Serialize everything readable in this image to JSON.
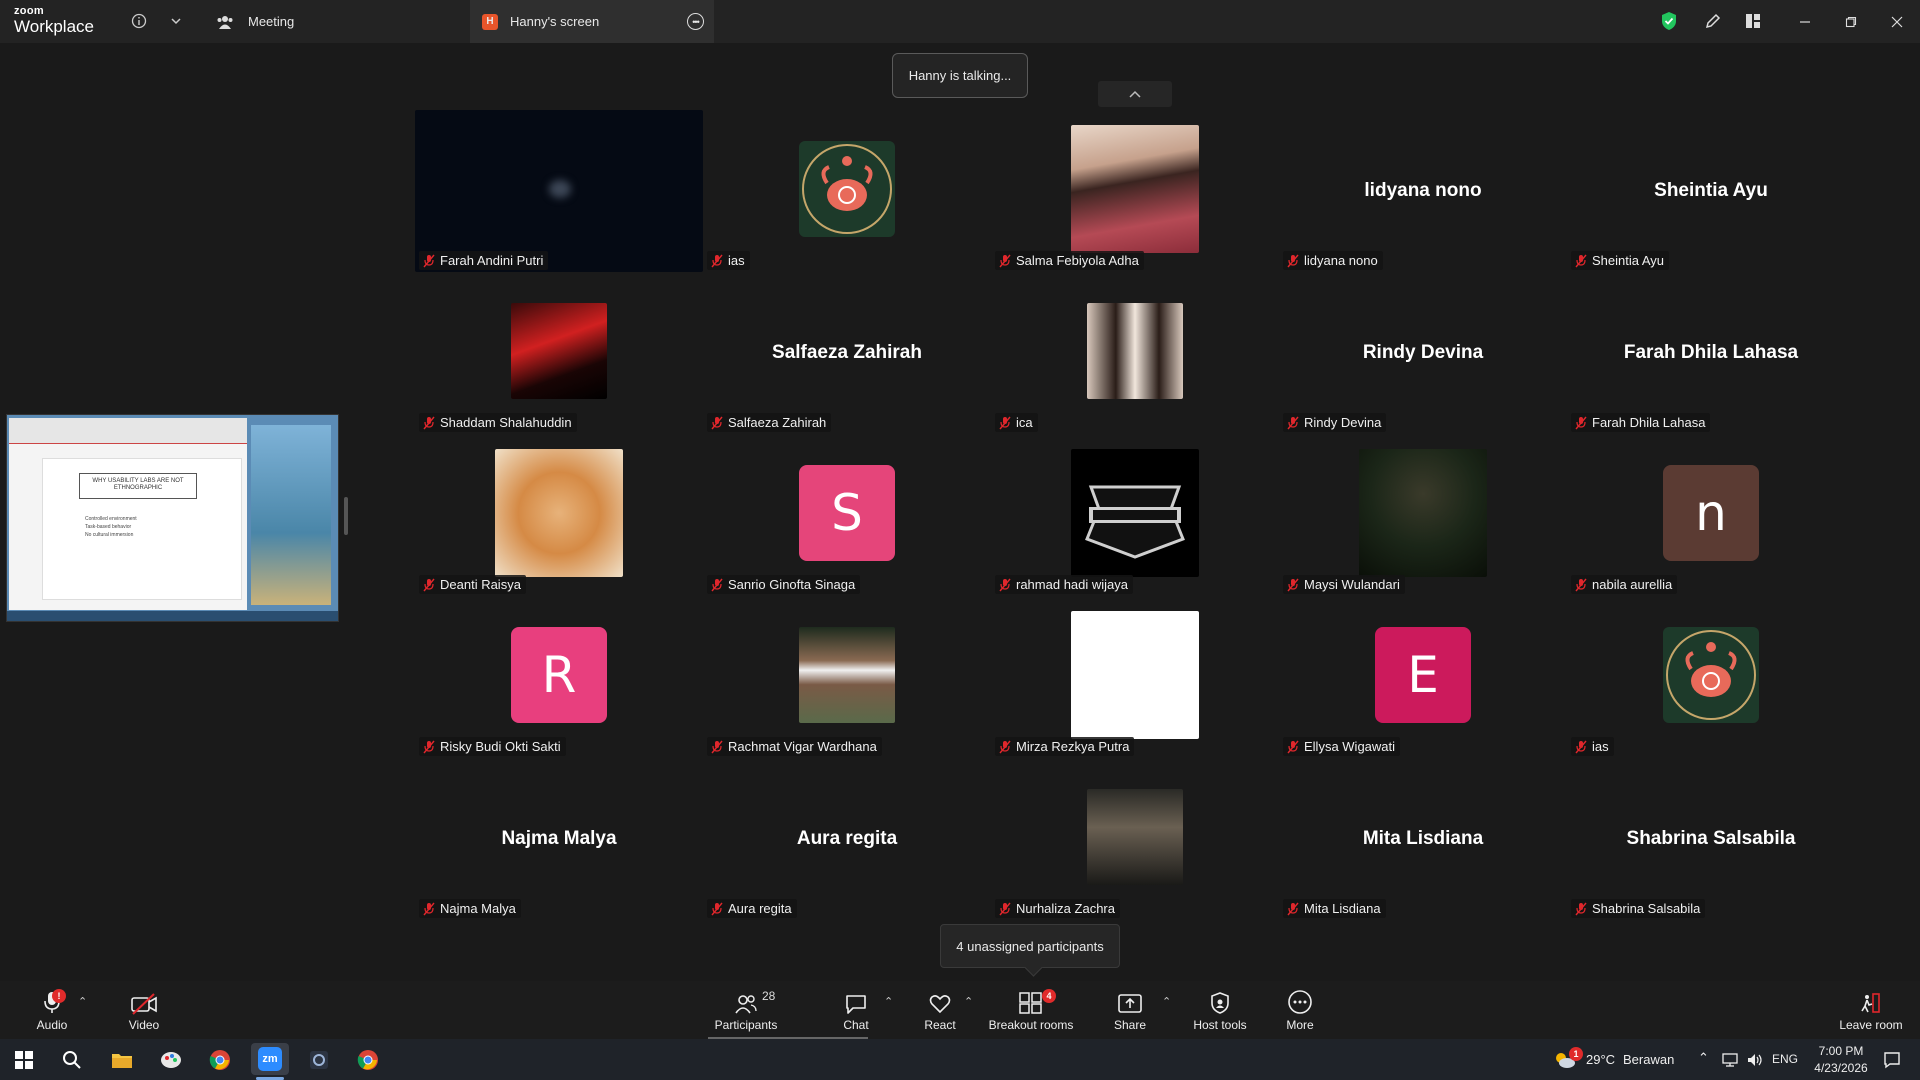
{
  "app": {
    "brand_line1": "zoom",
    "brand_line2": "Workplace"
  },
  "tabs": [
    {
      "label": "Meeting"
    },
    {
      "label": "Hanny's screen",
      "badge": "H"
    }
  ],
  "status": {
    "talking": "Hanny is talking..."
  },
  "participants_grid": [
    {
      "name": "Farah Andini Putri",
      "display": "dark-video"
    },
    {
      "name": "ias",
      "display": "crab-avatar"
    },
    {
      "name": "Salma Febiyola Adha",
      "display": "photo"
    },
    {
      "name": "lidyana nono",
      "display": "name",
      "center": "lidyana nono"
    },
    {
      "name": "Sheintia Ayu",
      "display": "name",
      "center": "Sheintia Ayu"
    },
    {
      "name": "Shaddam Shalahuddin",
      "display": "photo"
    },
    {
      "name": "Salfaeza Zahirah",
      "display": "name",
      "center": "Salfaeza Zahirah"
    },
    {
      "name": "ica",
      "display": "photo"
    },
    {
      "name": "Rindy Devina",
      "display": "name",
      "center": "Rindy Devina"
    },
    {
      "name": "Farah Dhila Lahasa",
      "display": "name",
      "center": "Farah Dhila Lahasa"
    },
    {
      "name": "Deanti Raisya",
      "display": "photo"
    },
    {
      "name": "Sanrio Ginofta Sinaga",
      "display": "letter",
      "letter": "S",
      "color": "#e5457a"
    },
    {
      "name": "rahmad hadi wijaya",
      "display": "logo"
    },
    {
      "name": "Maysi Wulandari",
      "display": "photo"
    },
    {
      "name": "nabila aurellia",
      "display": "letter",
      "letter": "n",
      "color": "#5b3b33"
    },
    {
      "name": "Risky Budi Okti Sakti",
      "display": "letter",
      "letter": "R",
      "color": "#e83f7e"
    },
    {
      "name": "Rachmat Vigar Wardhana",
      "display": "photo"
    },
    {
      "name": "Mirza Rezkya Putra",
      "display": "white"
    },
    {
      "name": "Ellysa Wigawati",
      "display": "letter",
      "letter": "E",
      "color": "#cc1a5c"
    },
    {
      "name": "ias",
      "display": "crab-avatar"
    },
    {
      "name": "Najma Malya",
      "display": "name",
      "center": "Najma Malya"
    },
    {
      "name": "Aura regita",
      "display": "name",
      "center": "Aura regita"
    },
    {
      "name": "Nurhaliza Zachra",
      "display": "photo"
    },
    {
      "name": "Mita Lisdiana",
      "display": "name",
      "center": "Mita Lisdiana"
    },
    {
      "name": "Shabrina Salsabila",
      "display": "name",
      "center": "Shabrina Salsabila"
    }
  ],
  "share_thumbnail": {
    "slide_title": "WHY USABILITY LABS ARE NOT ETHNOGRAPHIC",
    "bullets": [
      "Controlled environment",
      "Task-based behavior",
      "No cultural immersion"
    ]
  },
  "tooltip": {
    "unassigned": "4 unassigned participants"
  },
  "toolbar": {
    "audio": "Audio",
    "audio_badge": "!",
    "video": "Video",
    "participants": "Participants",
    "participants_count": "28",
    "chat": "Chat",
    "react": "React",
    "breakout": "Breakout rooms",
    "breakout_badge": "4",
    "share": "Share",
    "host_tools": "Host tools",
    "more": "More",
    "leave": "Leave room"
  },
  "taskbar": {
    "weather_temp": "29°C",
    "weather_desc": "Berawan",
    "lang": "ENG",
    "time": "7:00 PM",
    "date": "4/23/2026",
    "weather_badge": "1"
  },
  "colors": {
    "accent_green": "#22c55e",
    "mic_off_red": "#e0272c"
  }
}
